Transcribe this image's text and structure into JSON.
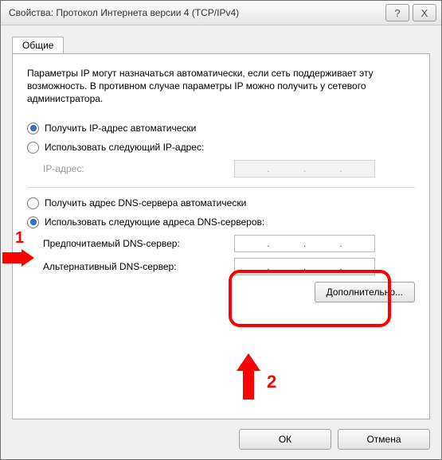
{
  "title": "Свойства: Протокол Интернета версии 4 (TCP/IPv4)",
  "titlebar_help": "?",
  "titlebar_close": "X",
  "tab_general": "Общие",
  "description": "Параметры IP могут назначаться автоматически, если сеть поддерживает эту возможность. В противном случае параметры IP можно получить у сетевого администратора.",
  "ip": {
    "auto_label": "Получить IP-адрес автоматически",
    "manual_label": "Использовать следующий IP-адрес:",
    "addr_label": "IP-адрес:"
  },
  "dns": {
    "auto_label": "Получить адрес DNS-сервера автоматически",
    "manual_label": "Использовать следующие адреса DNS-серверов:",
    "preferred_label": "Предпочитаемый DNS-сервер:",
    "alternate_label": "Альтернативный DNS-сервер:"
  },
  "advanced_btn": "Дополнительно...",
  "ok_btn": "ОК",
  "cancel_btn": "Отмена",
  "annotation": {
    "one": "1",
    "two": "2"
  }
}
